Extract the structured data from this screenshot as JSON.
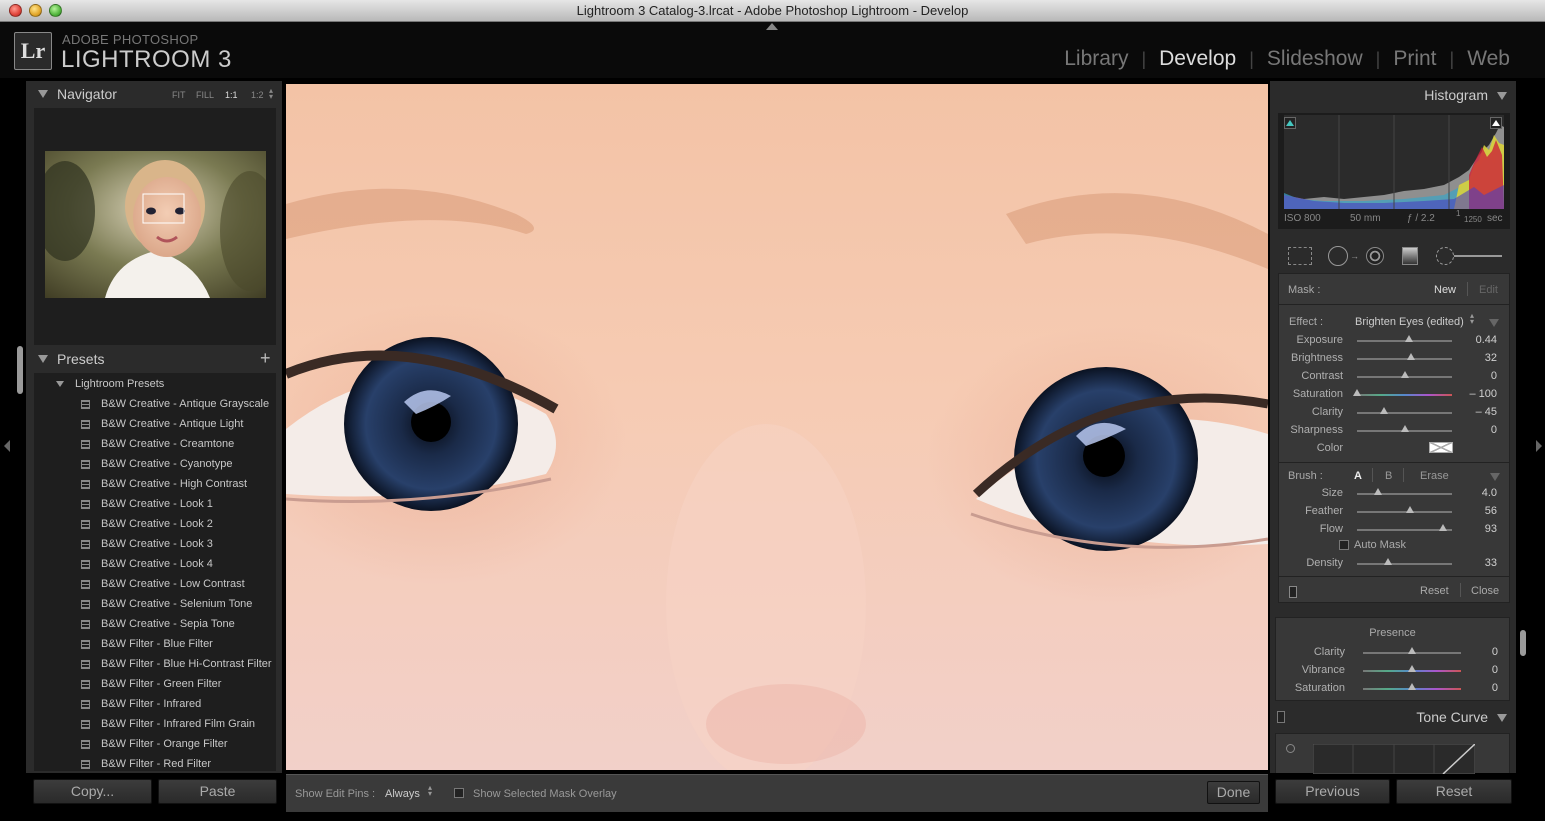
{
  "window": {
    "title": "Lightroom 3 Catalog-3.lrcat - Adobe Photoshop Lightroom - Develop"
  },
  "brand": {
    "logo": "Lr",
    "small": "ADOBE PHOTOSHOP",
    "big": "LIGHTROOM 3"
  },
  "modules": [
    {
      "label": "Library"
    },
    {
      "label": "Develop",
      "active": true
    },
    {
      "label": "Slideshow"
    },
    {
      "label": "Print"
    },
    {
      "label": "Web"
    }
  ],
  "navigator": {
    "title": "Navigator",
    "zoom": {
      "fit": "FIT",
      "fill": "FILL",
      "one": "1:1",
      "ratio": "1:2"
    }
  },
  "presets": {
    "title": "Presets",
    "add": "+",
    "group": "Lightroom Presets",
    "items": [
      "B&W Creative - Antique Grayscale",
      "B&W Creative - Antique Light",
      "B&W Creative - Creamtone",
      "B&W Creative - Cyanotype",
      "B&W Creative - High Contrast",
      "B&W Creative - Look 1",
      "B&W Creative - Look 2",
      "B&W Creative - Look 3",
      "B&W Creative - Look 4",
      "B&W Creative - Low Contrast",
      "B&W Creative - Selenium Tone",
      "B&W Creative - Sepia Tone",
      "B&W Filter - Blue Filter",
      "B&W Filter - Blue Hi-Contrast Filter",
      "B&W Filter - Green Filter",
      "B&W Filter - Infrared",
      "B&W Filter - Infrared Film Grain",
      "B&W Filter - Orange Filter",
      "B&W Filter - Red Filter"
    ]
  },
  "left_buttons": {
    "copy": "Copy...",
    "paste": "Paste"
  },
  "toolbar": {
    "show_pins_label": "Show Edit Pins :",
    "show_pins_value": "Always",
    "mask_overlay": "Show Selected Mask Overlay",
    "done": "Done"
  },
  "histogram": {
    "title": "Histogram",
    "iso": "ISO 800",
    "focal": "50 mm",
    "aperture": "ƒ / 2.2",
    "shutter_num": "1",
    "shutter_den": "1250",
    "shutter_unit": "sec"
  },
  "mask": {
    "label": "Mask :",
    "new": "New",
    "edit": "Edit"
  },
  "effect": {
    "label": "Effect :",
    "value": "Brighten Eyes (edited)",
    "sliders": [
      {
        "label": "Exposure",
        "value": "0.44",
        "pos": 0.55
      },
      {
        "label": "Brightness",
        "value": "32",
        "pos": 0.57
      },
      {
        "label": "Contrast",
        "value": "0",
        "pos": 0.5
      },
      {
        "label": "Saturation",
        "value": "– 100",
        "pos": 0.0
      },
      {
        "label": "Clarity",
        "value": "– 45",
        "pos": 0.28
      },
      {
        "label": "Sharpness",
        "value": "0",
        "pos": 0.5
      }
    ],
    "color_label": "Color"
  },
  "brush": {
    "label": "Brush :",
    "a": "A",
    "b": "B",
    "erase": "Erase",
    "sliders": [
      {
        "label": "Size",
        "value": "4.0",
        "pos": 0.22
      },
      {
        "label": "Feather",
        "value": "56",
        "pos": 0.56
      },
      {
        "label": "Flow",
        "value": "93",
        "pos": 0.9
      }
    ],
    "auto_mask": "Auto Mask",
    "density": {
      "label": "Density",
      "value": "33",
      "pos": 0.33
    },
    "reset": "Reset",
    "close": "Close"
  },
  "presence": {
    "title": "Presence",
    "sliders": [
      {
        "label": "Clarity",
        "value": "0",
        "pos": 0.5
      },
      {
        "label": "Vibrance",
        "value": "0",
        "pos": 0.5
      },
      {
        "label": "Saturation",
        "value": "0",
        "pos": 0.5
      }
    ]
  },
  "tone_curve": {
    "title": "Tone Curve"
  },
  "right_buttons": {
    "previous": "Previous",
    "reset": "Reset"
  }
}
